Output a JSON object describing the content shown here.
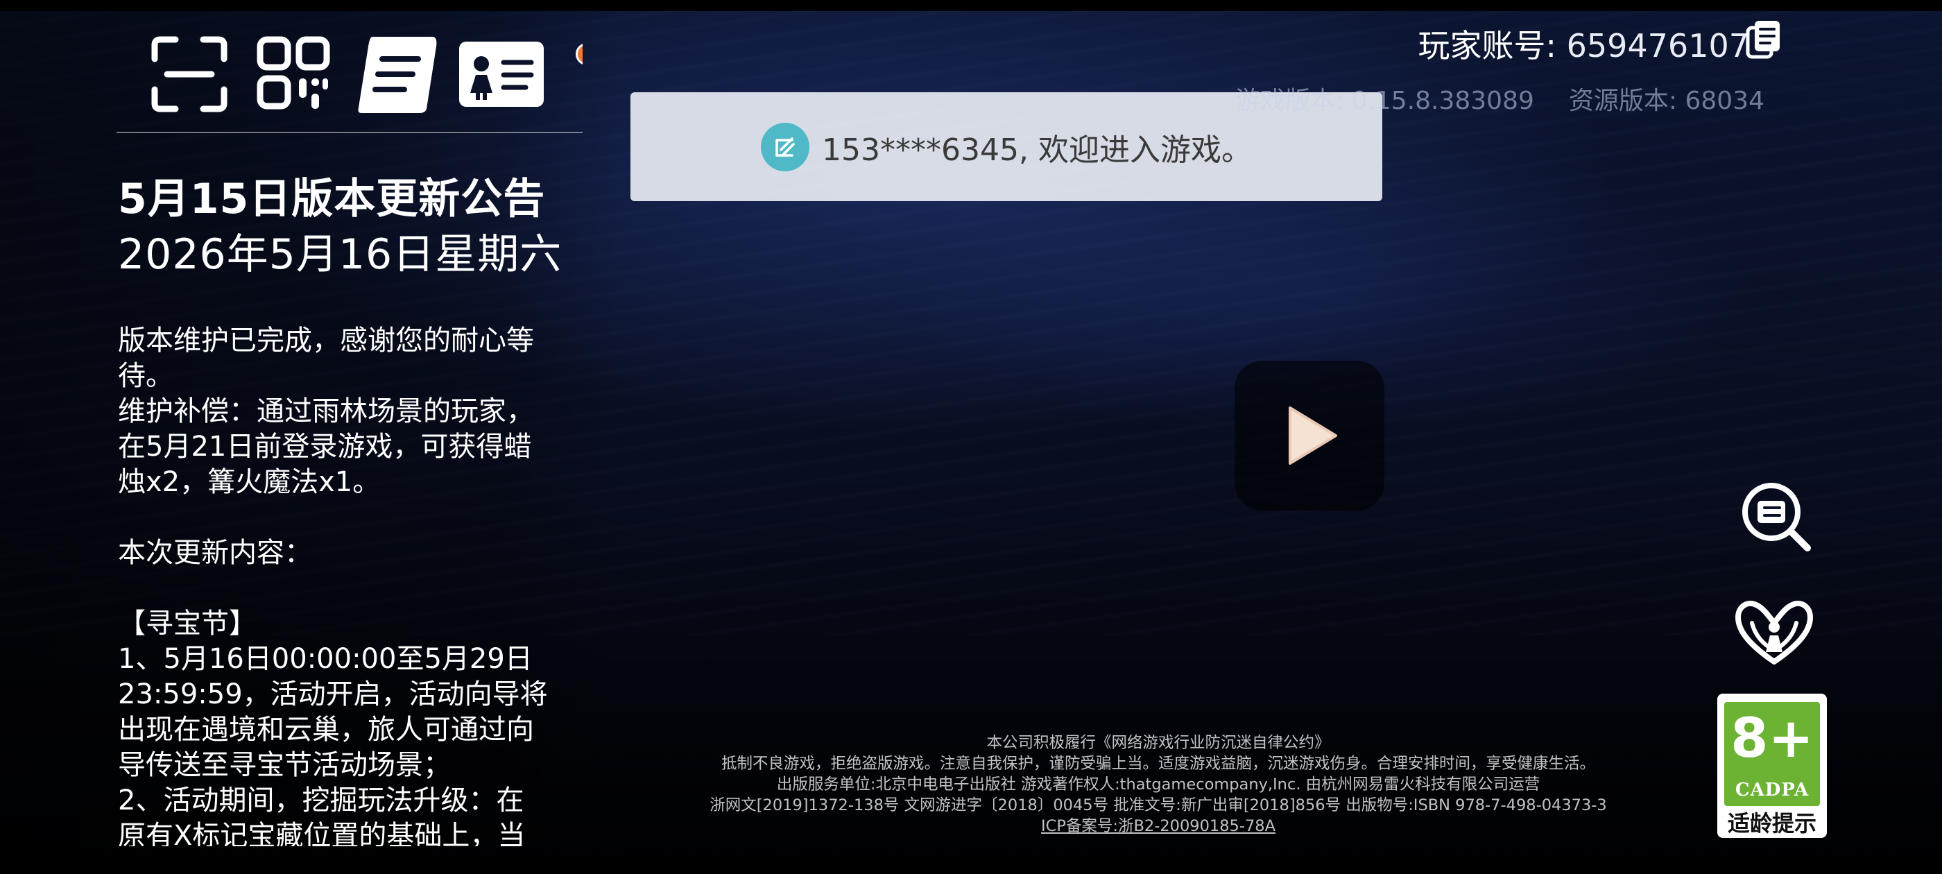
{
  "notice": {
    "title": "5月15日版本更新公告",
    "date": "2026年5月16日星期六",
    "lines": [
      "版本维护已完成，感谢您的耐心等",
      "待。",
      "维护补偿：通过雨林场景的玩家，",
      "在5月21日前登录游戏，可获得蜡",
      "烛x2，篝火魔法x1。",
      "",
      "本次更新内容：",
      "",
      "【寻宝节】",
      "1、5月16日00:00:00至5月29日",
      "23:59:59，活动开启，活动向导将",
      "出现在遇境和云巢，旅人可通过向",
      "导传送至寻宝节活动场景；",
      "2、活动期间，挖掘玩法升级：在",
      "原有X标记宝藏位置的基础上，当"
    ]
  },
  "top_icons": [
    "scan-icon",
    "qr-code-icon",
    "scroll-notice-icon",
    "id-card-icon"
  ],
  "toast": {
    "message": "153****6345, 欢迎进入游戏。",
    "icon": "netease-account-icon"
  },
  "account": {
    "label": "玩家账号:",
    "number": "659476107",
    "copy_icon": "copy-icon"
  },
  "versions": {
    "game_version": "游戏版本: 0.15.8.383089",
    "resource_version": "资源版本: 68034"
  },
  "play_button": {
    "icon": "play-icon"
  },
  "side_buttons": [
    "notice-search-icon",
    "guardian-family-icon"
  ],
  "age_rating": {
    "age": "8+",
    "org": "CADPA",
    "hint": "适龄提示",
    "color": "#6cb233"
  },
  "footer": {
    "lines": [
      "本公司积极履行《网络游戏行业防沉迷自律公约》",
      "抵制不良游戏，拒绝盗版游戏。注意自我保护，谨防受骗上当。适度游戏益脑，沉迷游戏伤身。合理安排时间，享受健康生活。",
      "出版服务单位:北京中电电子出版社 游戏著作权人:thatgamecompany,Inc. 由杭州网易雷火科技有限公司运营",
      "浙网文[2019]1372-138号 文网游进字〔2018〕0045号 批准文号:新广出审[2018]856号 出版物号:ISBN 978-7-498-04373-3"
    ],
    "icp": "ICP备案号:浙B2-20090185-78A"
  },
  "colors": {
    "notif_dot": "#f2782f",
    "toast_bg": "#e2e6ee",
    "toast_icon": "#4fb9c8"
  }
}
